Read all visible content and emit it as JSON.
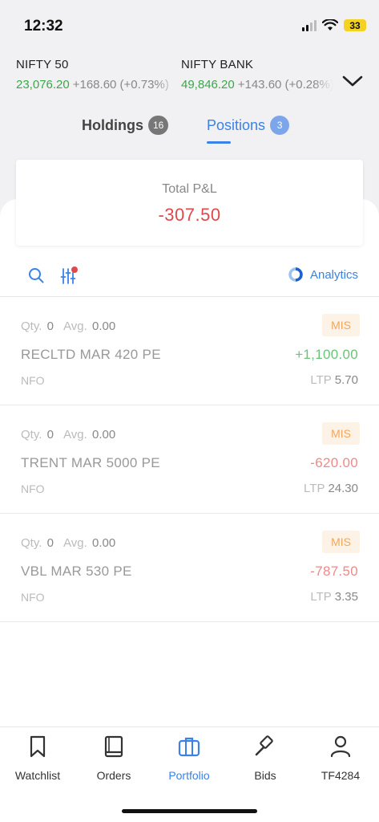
{
  "status_bar": {
    "time": "12:32",
    "battery": "33"
  },
  "tickers": [
    {
      "name": "NIFTY 50",
      "price": "23,076.20",
      "change": "+168.60 (+0.73%)"
    },
    {
      "name": "NIFTY BANK",
      "price": "49,846.20",
      "change": "+143.60 (+0.28%)"
    }
  ],
  "tabs": [
    {
      "label": "Holdings",
      "count": "16"
    },
    {
      "label": "Positions",
      "count": "3"
    }
  ],
  "pnl": {
    "label": "Total P&L",
    "value": "-307.50"
  },
  "toolbar": {
    "analytics_label": "Analytics"
  },
  "positions": [
    {
      "qty_label": "Qty.",
      "qty": "0",
      "avg_label": "Avg.",
      "avg": "0.00",
      "product": "MIS",
      "symbol": "RECLTD MAR 420 PE",
      "pnl": "+1,100.00",
      "exchange": "NFO",
      "ltp_label": "LTP",
      "ltp": "5.70"
    },
    {
      "qty_label": "Qty.",
      "qty": "0",
      "avg_label": "Avg.",
      "avg": "0.00",
      "product": "MIS",
      "symbol": "TRENT MAR 5000 PE",
      "pnl": "-620.00",
      "exchange": "NFO",
      "ltp_label": "LTP",
      "ltp": "24.30"
    },
    {
      "qty_label": "Qty.",
      "qty": "0",
      "avg_label": "Avg.",
      "avg": "0.00",
      "product": "MIS",
      "symbol": "VBL MAR 530 PE",
      "pnl": "-787.50",
      "exchange": "NFO",
      "ltp_label": "LTP",
      "ltp": "3.35"
    }
  ],
  "nav": [
    {
      "label": "Watchlist",
      "icon": "bookmark-icon"
    },
    {
      "label": "Orders",
      "icon": "book-icon"
    },
    {
      "label": "Portfolio",
      "icon": "briefcase-icon"
    },
    {
      "label": "Bids",
      "icon": "gavel-icon"
    },
    {
      "label": "TF4284",
      "icon": "user-icon"
    }
  ],
  "colors": {
    "accent": "#3a82e8",
    "profit": "#6cc27a",
    "loss": "#ec8a8c",
    "loss_total": "#e0494c",
    "product_badge": "#f2a65c"
  }
}
